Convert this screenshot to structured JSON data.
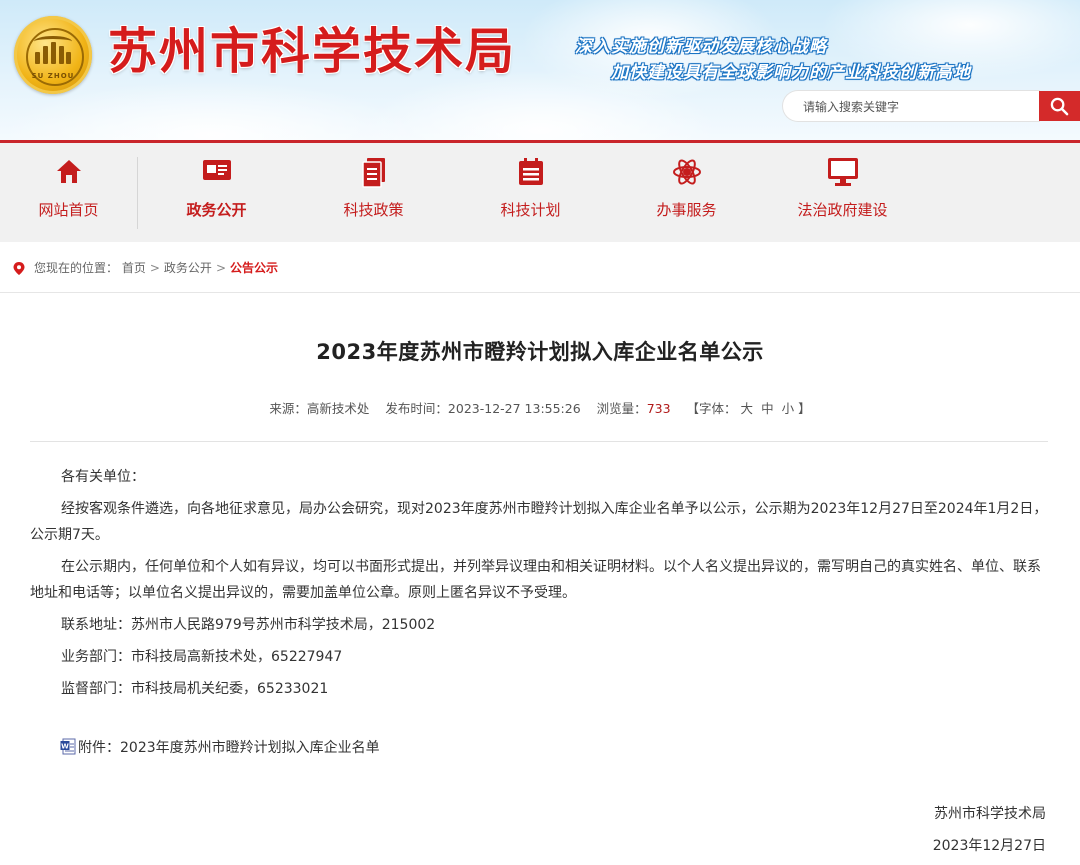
{
  "header": {
    "site_title": "苏州市科学技术局",
    "logo_text": "SU ZHOU",
    "slogan_line1": "深入实施创新驱动发展核心战略",
    "slogan_line2": "加快建设具有全球影响力的产业科技创新高地",
    "search": {
      "placeholder": "请输入搜索关键字",
      "button_icon": "search-icon"
    }
  },
  "nav": {
    "items": [
      {
        "label": "网站首页",
        "icon": "home-icon"
      },
      {
        "label": "政务公开",
        "icon": "card-icon",
        "active": true
      },
      {
        "label": "科技政策",
        "icon": "document-icon"
      },
      {
        "label": "科技计划",
        "icon": "calendar-list-icon"
      },
      {
        "label": "办事服务",
        "icon": "atom-icon"
      },
      {
        "label": "法治政府建设",
        "icon": "monitor-icon"
      }
    ],
    "accent_color": "#c41d1d"
  },
  "breadcrumb": {
    "prefix": "您现在的位置：",
    "items": [
      "首页",
      "政务公开",
      "公告公示"
    ],
    "separator": ">"
  },
  "article": {
    "title": "2023年度苏州市瞪羚计划拟入库企业名单公示",
    "meta": {
      "source_label": "来源：",
      "source": "高新技术处",
      "published_label": "发布时间：",
      "published": "2023-12-27 13:55:26",
      "views_label": "浏览量：",
      "views": "733",
      "font_open": "【字体：",
      "font_large": "大",
      "font_medium": "中",
      "font_small": "小",
      "font_close": "】"
    },
    "paragraphs": [
      "各有关单位：",
      "经按客观条件遴选，向各地征求意见，局办公会研究，现对2023年度苏州市瞪羚计划拟入库企业名单予以公示，公示期为2023年12月27日至2024年1月2日，公示期7天。",
      "在公示期内，任何单位和个人如有异议，均可以书面形式提出，并列举异议理由和相关证明材料。以个人名义提出异议的，需写明自己的真实姓名、单位、联系地址和电话等；以单位名义提出异议的，需要加盖单位公章。原则上匿名异议不予受理。",
      "联系地址：苏州市人民路979号苏州市科学技术局，215002",
      "业务部门：市科技局高新技术处，65227947",
      "监督部门：市科技局机关纪委，65233021"
    ],
    "attachment": "附件：2023年度苏州市瞪羚计划拟入库企业名单",
    "signature": "苏州市科学技术局",
    "date": "2023年12月27日"
  }
}
